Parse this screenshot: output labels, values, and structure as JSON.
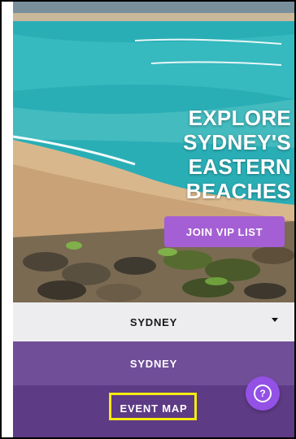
{
  "hero": {
    "title_lines": [
      "EXPLORE",
      "SYDNEY'S",
      "EASTERN",
      "BEACHES"
    ],
    "cta_label": "JOIN VIP LIST"
  },
  "location_select": {
    "selected": "SYDNEY",
    "icon": "chevron-down-icon"
  },
  "menu": {
    "items": [
      {
        "label": "SYDNEY"
      },
      {
        "label": "EVENT MAP"
      }
    ]
  },
  "help_button": {
    "symbol": "?",
    "icon": "help-icon"
  },
  "colors": {
    "cta": "#a55fd4",
    "menu_bg": "#5e3b85",
    "menu_active": "#714e98",
    "highlight": "#f4ea10",
    "help": "#9351e6"
  }
}
